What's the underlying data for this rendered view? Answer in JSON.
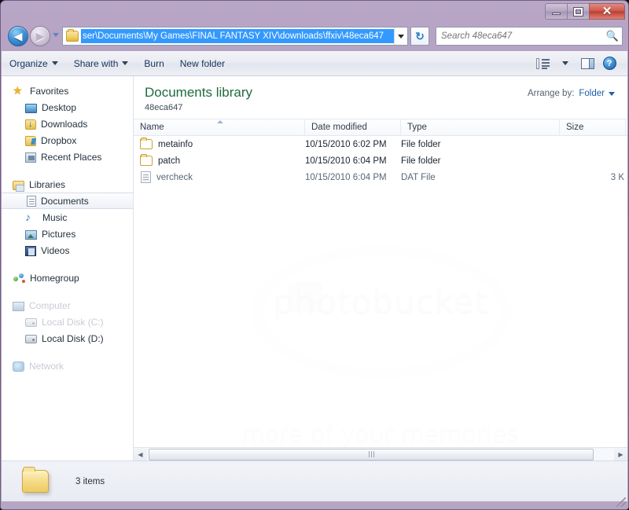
{
  "window": {
    "minimize_label": "Minimize",
    "maximize_label": "Restore",
    "close_label": "✕"
  },
  "nav": {
    "back_label": "◀",
    "forward_label": "▶",
    "history_dropdown_label": "Recent locations",
    "refresh_label": "↻"
  },
  "address": {
    "path": "ser\\Documents\\My Games\\FINAL FANTASY XIV\\downloads\\ffxiv\\48eca647",
    "dropdown_label": "Previous locations"
  },
  "search": {
    "placeholder": "Search 48eca647",
    "value": ""
  },
  "toolbar": {
    "organize_label": "Organize",
    "share_with_label": "Share with",
    "burn_label": "Burn",
    "new_folder_label": "New folder",
    "view_label": "Change your view",
    "preview_pane_label": "Show the preview pane",
    "help_label": "?"
  },
  "sidebar": {
    "groups": [
      {
        "header": {
          "label": "Favorites",
          "icon": "star-icon"
        },
        "items": [
          {
            "label": "Desktop",
            "icon": "desktop-icon",
            "selected": false,
            "faded": false
          },
          {
            "label": "Downloads",
            "icon": "downloads-icon",
            "selected": false,
            "faded": false
          },
          {
            "label": "Dropbox",
            "icon": "dropbox-icon",
            "selected": false,
            "faded": false
          },
          {
            "label": "Recent Places",
            "icon": "recent-places-icon",
            "selected": false,
            "faded": false
          }
        ]
      },
      {
        "header": {
          "label": "Libraries",
          "icon": "libraries-icon"
        },
        "items": [
          {
            "label": "Documents",
            "icon": "documents-icon",
            "selected": true,
            "faded": false
          },
          {
            "label": "Music",
            "icon": "music-icon",
            "selected": false,
            "faded": false
          },
          {
            "label": "Pictures",
            "icon": "pictures-icon",
            "selected": false,
            "faded": false
          },
          {
            "label": "Videos",
            "icon": "videos-icon",
            "selected": false,
            "faded": false
          }
        ]
      },
      {
        "header": {
          "label": "Homegroup",
          "icon": "homegroup-icon"
        },
        "items": []
      },
      {
        "header": {
          "label": "Computer",
          "icon": "computer-icon",
          "faded": true
        },
        "items": [
          {
            "label": "Local Disk (C:)",
            "icon": "disk-icon",
            "selected": false,
            "faded": true
          },
          {
            "label": "Local Disk (D:)",
            "icon": "disk-icon",
            "selected": false,
            "faded": false
          }
        ]
      },
      {
        "header": {
          "label": "Network",
          "icon": "network-icon",
          "faded": true
        },
        "items": []
      }
    ]
  },
  "library": {
    "title": "Documents library",
    "subtitle": "48eca647",
    "arrange_by_label": "Arrange by:",
    "arrange_by_value": "Folder"
  },
  "columns": {
    "name": "Name",
    "date_modified": "Date modified",
    "type": "Type",
    "size": "Size",
    "sorted_by": "Name",
    "sort_direction": "ascending"
  },
  "files": [
    {
      "name": "metainfo",
      "date_modified": "10/15/2010 6:02 PM",
      "type": "File folder",
      "size": "",
      "icon": "folder-icon"
    },
    {
      "name": "patch",
      "date_modified": "10/15/2010 6:04 PM",
      "type": "File folder",
      "size": "",
      "icon": "folder-icon"
    },
    {
      "name": "vercheck",
      "date_modified": "10/15/2010 6:04 PM",
      "type": "DAT File",
      "size": "3 K",
      "icon": "dat-file-icon"
    }
  ],
  "watermark": {
    "line1": "photobucket",
    "line2": "more of your memories"
  },
  "scrollbar": {
    "left_arrow": "◀",
    "right_arrow": "▶"
  },
  "status": {
    "items_text": "3 items"
  }
}
